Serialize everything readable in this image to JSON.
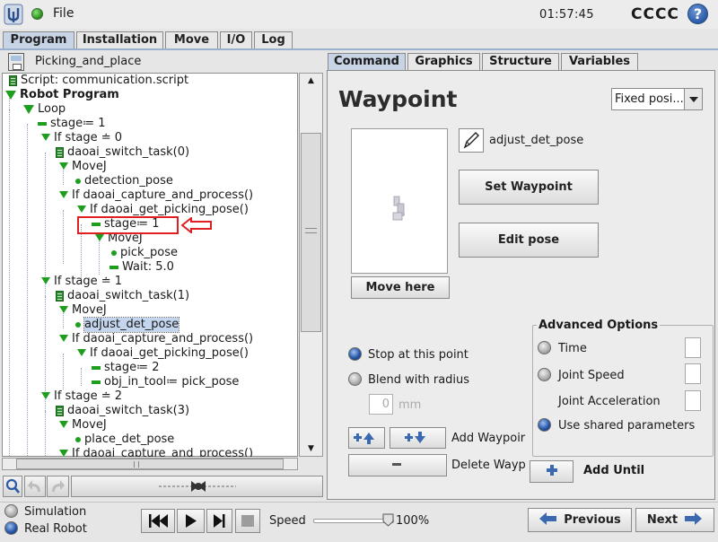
{
  "topbar": {
    "file_menu": "File",
    "clock": "01:57:45",
    "robot_name": "CCCC",
    "help_label": "?"
  },
  "main_tabs": [
    {
      "label": "Program",
      "active": true
    },
    {
      "label": "Installation",
      "active": false
    },
    {
      "label": "Move",
      "active": false
    },
    {
      "label": "I/O",
      "active": false
    },
    {
      "label": "Log",
      "active": false
    }
  ],
  "program": {
    "name": "Picking_and_place"
  },
  "tree": {
    "nodes": [
      {
        "text": "Script: communication.script",
        "icon": "script-icon"
      },
      {
        "text": "Robot Program",
        "icon": "triangle-icon",
        "bold": true
      },
      {
        "text": "Loop",
        "icon": "triangle-icon"
      },
      {
        "text": "stage≔ 1",
        "icon": "assignment-icon"
      },
      {
        "text": "If stage ≐ 0",
        "icon": "condition-icon"
      },
      {
        "text": "daoai_switch_task(0)",
        "icon": "script-icon"
      },
      {
        "text": "MoveJ",
        "icon": "condition-icon"
      },
      {
        "text": "detection_pose",
        "icon": "waypoint-icon"
      },
      {
        "text": "If daoai_capture_and_process()",
        "icon": "condition-icon"
      },
      {
        "text": "If daoai_get_picking_pose()",
        "icon": "condition-icon"
      },
      {
        "text": "stage≔ 1",
        "icon": "assignment-icon"
      },
      {
        "text": "MoveJ",
        "icon": "condition-icon"
      },
      {
        "text": "pick_pose",
        "icon": "waypoint-icon"
      },
      {
        "text": "Wait: 5.0",
        "icon": "assignment-icon"
      },
      {
        "text": "If stage ≐ 1",
        "icon": "condition-icon"
      },
      {
        "text": "daoai_switch_task(1)",
        "icon": "script-icon"
      },
      {
        "text": "MoveJ",
        "icon": "condition-icon"
      },
      {
        "text": "adjust_det_pose",
        "icon": "waypoint-icon",
        "selected": true
      },
      {
        "text": "If daoai_capture_and_process()",
        "icon": "condition-icon"
      },
      {
        "text": "If daoai_get_picking_pose()",
        "icon": "condition-icon"
      },
      {
        "text": "stage≔ 2",
        "icon": "assignment-icon"
      },
      {
        "text": "obj_in_tool≔ pick_pose",
        "icon": "assignment-icon"
      },
      {
        "text": "If stage ≐ 2",
        "icon": "condition-icon"
      },
      {
        "text": "daoai_switch_task(3)",
        "icon": "script-icon"
      },
      {
        "text": "MoveJ",
        "icon": "condition-icon"
      },
      {
        "text": "place_det_pose",
        "icon": "waypoint-icon"
      },
      {
        "text": "If daoai_capture_and_process()",
        "icon": "condition-icon"
      }
    ]
  },
  "sub_tabs": [
    {
      "label": "Command",
      "active": true
    },
    {
      "label": "Graphics",
      "active": false
    },
    {
      "label": "Structure",
      "active": false
    },
    {
      "label": "Variables",
      "active": false
    }
  ],
  "waypoint": {
    "title": "Waypoint",
    "pose_type": "Fixed posi...",
    "pose_name": "adjust_det_pose",
    "move_here": "Move here",
    "set_waypoint": "Set Waypoint",
    "edit_pose": "Edit pose",
    "stop_label": "Stop at this point",
    "blend_label": "Blend with radius",
    "blend_value": "0",
    "blend_unit": "mm",
    "add_waypoint": "Add Waypoir",
    "delete_waypoint": "Delete Wayp",
    "add_until": "Add Until"
  },
  "advanced": {
    "title": "Advanced Options",
    "time": "Time",
    "joint_speed": "Joint Speed",
    "joint_accel": "Joint Acceleration",
    "shared": "Use shared parameters"
  },
  "bottom": {
    "simulation": "Simulation",
    "real_robot": "Real Robot",
    "speed_label": "Speed",
    "speed_value": "100%",
    "speed_fraction": 1.0,
    "previous": "Previous",
    "next": "Next"
  },
  "colors": {
    "accent": "#c7d4e6",
    "tree_green": "#1e9e1e",
    "highlight_red": "#e02020"
  }
}
